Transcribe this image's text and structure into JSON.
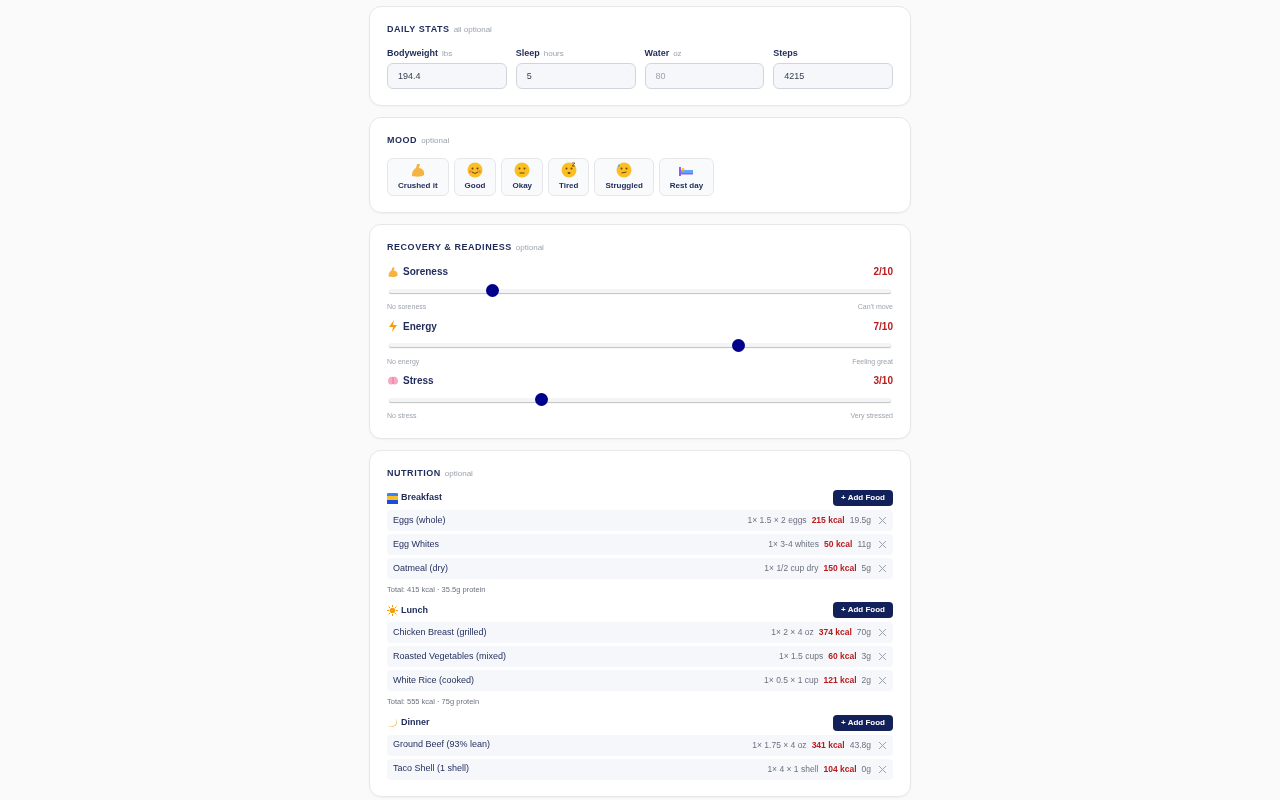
{
  "daily_stats": {
    "title": "DAILY STATS",
    "note": "all optional",
    "fields": [
      {
        "label": "Bodyweight",
        "unit": "lbs",
        "value": "194.4"
      },
      {
        "label": "Sleep",
        "unit": "hours",
        "value": "5"
      },
      {
        "label": "Water",
        "unit": "oz",
        "placeholder": "80"
      },
      {
        "label": "Steps",
        "value": "4215"
      }
    ]
  },
  "mood": {
    "title": "MOOD",
    "note": "optional",
    "options": [
      {
        "label": "Crushed it",
        "selected": false
      },
      {
        "label": "Good",
        "selected": false
      },
      {
        "label": "Okay",
        "selected": false
      },
      {
        "label": "Tired",
        "selected": false
      },
      {
        "label": "Struggled",
        "selected": false
      },
      {
        "label": "Rest day",
        "selected": false
      }
    ]
  },
  "recovery": {
    "title": "RECOVERY & READINESS",
    "note": "optional",
    "sliders": [
      {
        "label": "Soreness",
        "reading": "2/10",
        "level": 0.2,
        "min_label": "No soreness",
        "max_label": "Can't move"
      },
      {
        "label": "Energy",
        "reading": "7/10",
        "level": 0.7,
        "min_label": "No energy",
        "max_label": "Feeling great"
      },
      {
        "label": "Stress",
        "reading": "3/10",
        "level": 0.3,
        "min_label": "No stress",
        "max_label": "Very stressed"
      }
    ]
  },
  "nutrition": {
    "title": "NUTRITION",
    "note": "optional",
    "meals": [
      {
        "name": "Breakfast",
        "button": "+ Add Food",
        "total": "Total: 415 kcal · 35.5g protein",
        "items": [
          {
            "name": "Eggs (whole)",
            "serving": "1× 1.5 × 2 eggs",
            "kcal": "215 kcal",
            "protein": "19.5g"
          },
          {
            "name": "Egg Whites",
            "serving": "1× 3-4 whites",
            "kcal": "50 kcal",
            "protein": "11g"
          },
          {
            "name": "Oatmeal (dry)",
            "serving": "1× 1/2 cup dry",
            "kcal": "150 kcal",
            "protein": "5g"
          }
        ]
      },
      {
        "name": "Lunch",
        "button": "+ Add Food",
        "total": "Total: 555 kcal · 75g protein",
        "items": [
          {
            "name": "Chicken Breast (grilled)",
            "serving": "1× 2 × 4 oz",
            "kcal": "374 kcal",
            "protein": "70g"
          },
          {
            "name": "Roasted Vegetables (mixed)",
            "serving": "1× 1.5 cups",
            "kcal": "60 kcal",
            "protein": "3g"
          },
          {
            "name": "White Rice (cooked)",
            "serving": "1× 0.5 × 1 cup",
            "kcal": "121 kcal",
            "protein": "2g"
          }
        ]
      },
      {
        "name": "Dinner",
        "button": "+ Add Food",
        "items": [
          {
            "name": "Ground Beef (93% lean)",
            "serving": "1× 1.75 × 4 oz",
            "kcal": "341 kcal",
            "protein": "43.8g"
          },
          {
            "name": "Taco Shell (1 shell)",
            "serving": "1× 4 × 1 shell",
            "kcal": "104 kcal",
            "protein": "0g"
          }
        ]
      }
    ]
  }
}
